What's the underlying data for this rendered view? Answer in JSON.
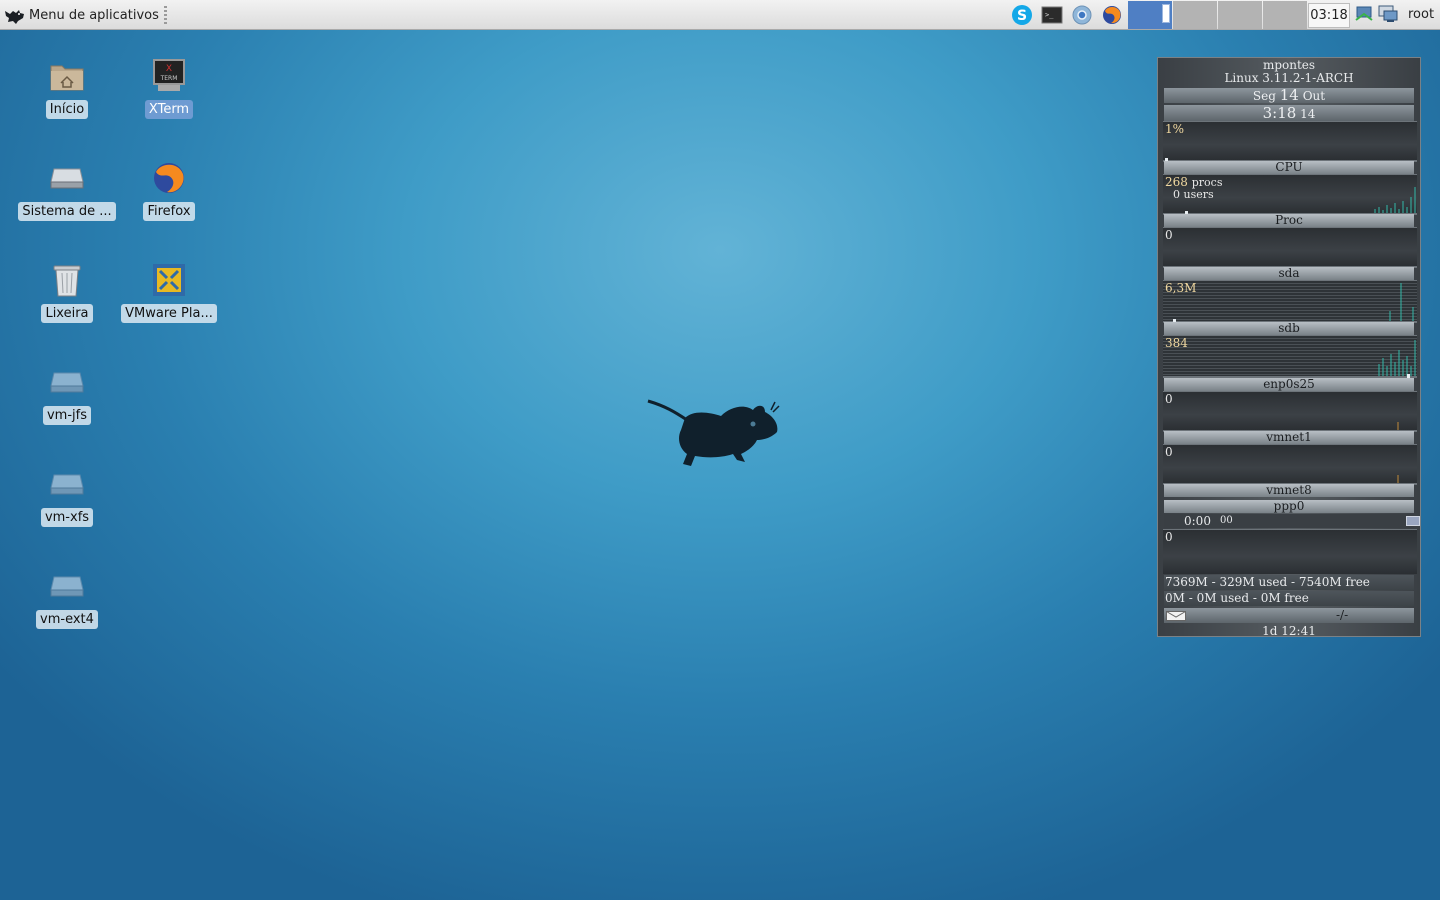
{
  "panel": {
    "app_menu_label": "Menu de aplicativos",
    "launchers": [
      "skype-icon",
      "terminal-icon",
      "chromium-icon",
      "firefox-icon"
    ],
    "workspaces": [
      "1",
      "2",
      "3",
      "4"
    ],
    "active_workspace": 1,
    "clock": "03:18",
    "user": "root"
  },
  "desktop": {
    "icons": [
      {
        "label": "Início",
        "icon": "home-folder-icon"
      },
      {
        "label": "XTerm",
        "icon": "xterm-icon"
      },
      {
        "label": "Sistema de ...",
        "icon": "drive-icon"
      },
      {
        "label": "Firefox",
        "icon": "firefox-icon"
      },
      {
        "label": "Lixeira",
        "icon": "trash-icon"
      },
      {
        "label": "VMware Pla...",
        "icon": "vmware-icon"
      },
      {
        "label": "vm-jfs",
        "icon": "drive-icon"
      },
      {
        "label": "vm-xfs",
        "icon": "drive-icon"
      },
      {
        "label": "vm-ext4",
        "icon": "drive-icon"
      }
    ]
  },
  "gkrellm": {
    "hostname": "mpontes",
    "kernel": "Linux 3.11.2-1-ARCH",
    "date_day": "Seg",
    "date_num": "14",
    "date_month": "Out",
    "time": "3:18",
    "time_sec": "14",
    "cpu_value": "1%",
    "cpu_label": "CPU",
    "procs": "268",
    "procs_unit": "procs",
    "users": "0",
    "users_unit": "users",
    "proc_label": "Proc",
    "disk1_value": "0",
    "disk1_label": "sda",
    "disk2_value": "6,3M",
    "disk2_label": "sdb",
    "net1_value": "384",
    "net1_label": "enp0s25",
    "net2_value": "0",
    "net2_label": "vmnet1",
    "net3_value": "0",
    "net3_label": "vmnet8",
    "ppp_label": "ppp0",
    "ppp_time": "0:00",
    "ppp_sec": "00",
    "ppp_value": "0",
    "mem": "7369M - 329M used - 7540M free",
    "swap": "0M - 0M used - 0M free",
    "mail": "-/-",
    "uptime": "1d 12:41"
  }
}
